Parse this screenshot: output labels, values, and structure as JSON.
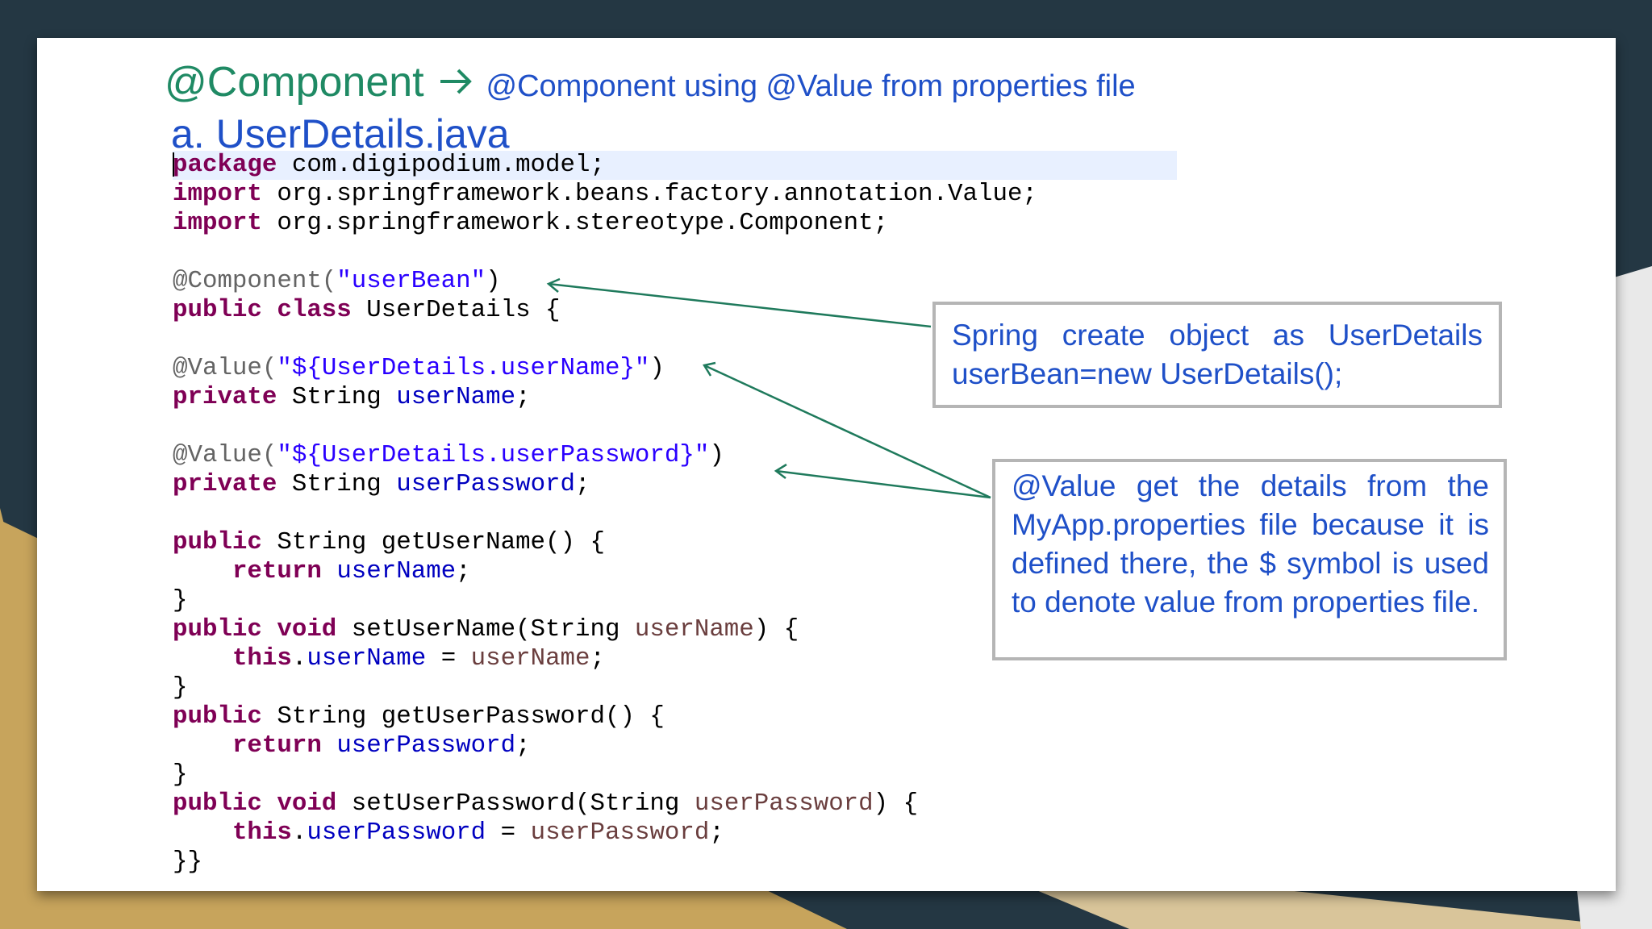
{
  "slide": {
    "title": "@Component",
    "title_arrow_icon": "right-arrow-icon",
    "title_suffix": "@Component using @Value from properties file",
    "subtitle": "a. UserDetails.java"
  },
  "code": {
    "line1": {
      "kw": "package",
      "rest": " com.digipodium.model;"
    },
    "line2": {
      "kw": "import",
      "rest": " org.springframework.beans.factory.annotation.Value;"
    },
    "line3": {
      "kw": "import",
      "rest": " org.springframework.stereotype.Component;"
    },
    "line4": {
      "ann": "@Component(",
      "str": "\"userBean\"",
      "tail": ")"
    },
    "line5": {
      "kw": "public class",
      "rest": " UserDetails {"
    },
    "line6": {
      "ann": "@Value(",
      "str": "\"${UserDetails.userName}\"",
      "tail": ")"
    },
    "line7": {
      "kw": "private",
      "rest": " String ",
      "fld": "userName",
      "tail": ";"
    },
    "line8": {
      "ann": "@Value(",
      "str": "\"${UserDetails.userPassword}\"",
      "tail": ")"
    },
    "line9": {
      "kw": "private",
      "rest": " String ",
      "fld": "userPassword",
      "tail": ";"
    },
    "line10": {
      "kw": "public",
      "rest": " String getUserName() {"
    },
    "line11": {
      "indent": "    ",
      "kw": "return",
      "sp": " ",
      "fld": "userName",
      "tail": ";"
    },
    "line12": {
      "text": "}"
    },
    "line13": {
      "kw": "public void",
      "rest": " setUserName(String ",
      "prm": "userName",
      "tail": ") {"
    },
    "line14": {
      "indent": "    ",
      "kw": "this",
      "dot": ".",
      "fld": "userName",
      "eq": " = ",
      "prm": "userName",
      "tail": ";"
    },
    "line15": {
      "text": "}"
    },
    "line16": {
      "kw": "public",
      "rest": " String getUserPassword() {"
    },
    "line17": {
      "indent": "    ",
      "kw": "return",
      "sp": " ",
      "fld": "userPassword",
      "tail": ";"
    },
    "line18": {
      "text": "}"
    },
    "line19": {
      "kw": "public void",
      "rest": " setUserPassword(String ",
      "prm": "userPassword",
      "tail": ") {"
    },
    "line20": {
      "indent": "    ",
      "kw": "this",
      "dot": ".",
      "fld": "userPassword",
      "eq": " = ",
      "prm": "userPassword",
      "tail": ";"
    },
    "line21": {
      "text": "}}"
    }
  },
  "callouts": {
    "bean": {
      "line1": "Spring create object as UserDetails",
      "line2": "userBean=new UserDetails();"
    },
    "value": "@Value get the details from the MyApp.properties file because it is defined there, the $ symbol is used to denote value from properties file."
  },
  "colors": {
    "title_green": "#1f8a64",
    "text_blue": "#1f50c8",
    "keyword": "#7f0055",
    "string": "#2a00ff",
    "field": "#0000c0",
    "annotation": "#646464",
    "background_navy": "#243743",
    "background_gold": "#c7a45c"
  }
}
